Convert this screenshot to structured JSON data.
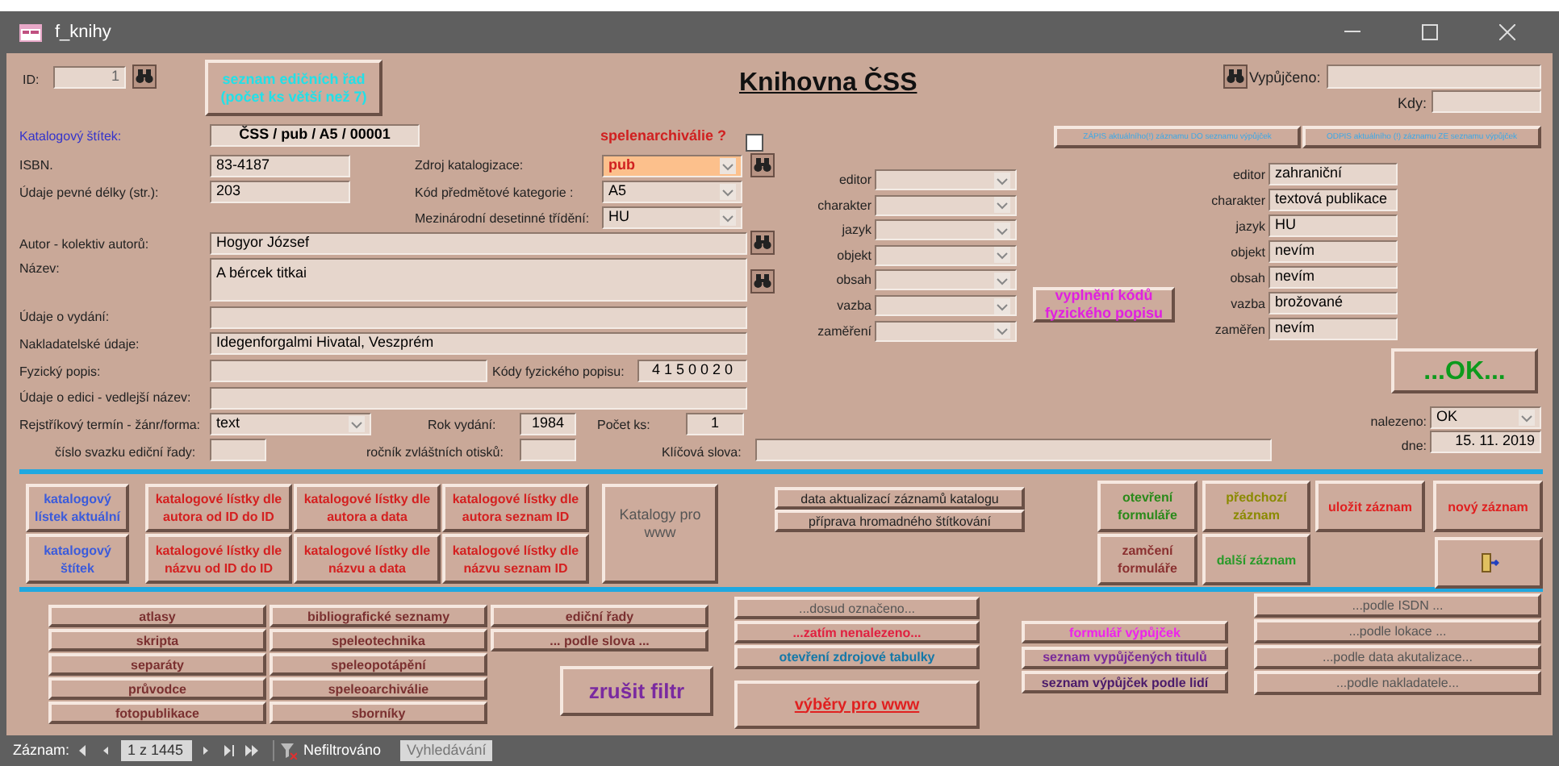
{
  "window": {
    "title": "f_knihy"
  },
  "header": {
    "title": "Knihovna ČSS",
    "id_label": "ID:",
    "id_value": "1",
    "editions_button": "seznam edičních řad (počet ks větší než 7)",
    "loaned_label": "Vypůjčeno:",
    "when_label": "Kdy:"
  },
  "catalog_label": {
    "label": "Katalogový štítek:",
    "value": "ČSS / pub / A5 / 00001"
  },
  "speleo": {
    "label": "spelenarchiválie ?",
    "checked": false
  },
  "loan_buttons": [
    "ZÁPIS aktuálního(!) záznamu DO seznamu výpůjček",
    "ODPIS aktuálního (!) záznamu ZE seznamu výpůjček"
  ],
  "fields": [
    {
      "kind": "text",
      "label": "ISBN.",
      "value": "83-4187",
      "highlighted": false
    },
    {
      "kind": "text",
      "label": "Údaje pevné délky (str.):",
      "value": "203",
      "highlighted": false
    },
    {
      "kind": "combo",
      "label": "Zdroj katalogizace:",
      "value": "pub",
      "highlighted": true
    },
    {
      "kind": "combo",
      "label": "Kód předmětové kategorie :",
      "value": "A5",
      "highlighted": false
    },
    {
      "kind": "combo",
      "label": "Mezinárodní desetinné třídění:",
      "value": "HU",
      "highlighted": false
    },
    {
      "kind": "text",
      "label": "Autor - kolektiv autorů:",
      "value": "Hogyor József",
      "highlighted": false
    },
    {
      "kind": "text",
      "label": "Název:",
      "value": "A bércek titkai",
      "highlighted": false
    },
    {
      "kind": "text",
      "label": "Údaje o vydání:",
      "highlighted": false
    },
    {
      "kind": "text",
      "label": "Nakladatelské údaje:",
      "value": "Idegenforgalmi Hivatal, Veszprém",
      "highlighted": false
    },
    {
      "kind": "text",
      "label": "Fyzický popis:",
      "highlighted": false
    },
    {
      "kind": "text",
      "label": "Kódy fyzického popisu:",
      "value": "4 1 5 0 0 2 0",
      "highlighted": false
    },
    {
      "kind": "text",
      "label": "Údaje o edici - vedlejší název:",
      "highlighted": false
    },
    {
      "kind": "combo",
      "label": "Rejstříkový termín - žánr/forma:",
      "value": "text",
      "highlighted": false
    },
    {
      "kind": "text",
      "label": "Rok vydání:",
      "value": "1984",
      "highlighted": false
    },
    {
      "kind": "text",
      "label": "Počet ks:",
      "value": "1",
      "highlighted": false
    },
    {
      "kind": "text",
      "label": "číslo svazku ediční řady:",
      "highlighted": false
    },
    {
      "kind": "text",
      "label": "ročník zvláštních otisků:",
      "highlighted": false
    },
    {
      "kind": "text",
      "label": "Klíčová slova:",
      "highlighted": false
    }
  ],
  "code_filters": [
    {
      "label": "editor"
    },
    {
      "label": "charakter"
    },
    {
      "label": "jazyk"
    },
    {
      "label": "objekt"
    },
    {
      "label": "obsah"
    },
    {
      "label": "vazba"
    },
    {
      "label": "zaměření"
    }
  ],
  "fill_codes_button": "vyplnění kódů fyzického popisu",
  "code_values": [
    {
      "label": "editor",
      "value": "zahraniční"
    },
    {
      "label": "charakter",
      "value": "textová publikace"
    },
    {
      "label": "jazyk",
      "value": "HU"
    },
    {
      "label": "objekt",
      "value": "nevím"
    },
    {
      "label": "obsah",
      "value": "nevím"
    },
    {
      "label": "vazba",
      "value": "brožované"
    },
    {
      "label": "zaměřen",
      "value": "nevím"
    }
  ],
  "ok_button": "...OK...",
  "found": {
    "label": "nalezeno:",
    "value": "OK"
  },
  "date": {
    "label": "dne:",
    "value": "15. 11. 2019"
  },
  "print_buttons": [
    {
      "label": "katalogový lístek aktuální",
      "color": "#3b5bdb"
    },
    {
      "label": "katalogové lístky dle autora od ID do ID",
      "color": "#d42020"
    },
    {
      "label": "katalogové lístky dle autora a data",
      "color": "#d42020"
    },
    {
      "label": "katalogové lístky dle autora seznam ID",
      "color": "#d42020"
    },
    {
      "label": "Katalogy pro www",
      "color": "#555555"
    },
    {
      "label": "katalogový štítek",
      "color": "#3b5bdb"
    },
    {
      "label": "katalogové lístky dle názvu od ID do ID",
      "color": "#d42020"
    },
    {
      "label": "katalogové lístky dle názvu a data",
      "color": "#d42020"
    },
    {
      "label": "katalogové lístky dle názvu seznam ID",
      "color": "#d42020"
    }
  ],
  "catalog_buttons": [
    "data aktualizací záznamů katalogu",
    "příprava hromadného štítkování"
  ],
  "record_buttons": [
    {
      "kind": "text",
      "label": "otevření formuláře",
      "color": "#2a8a1a"
    },
    {
      "kind": "text",
      "label": "předchozí záznam",
      "color": "#8a8a00"
    },
    {
      "kind": "text",
      "label": "uložit záznam",
      "color": "#e02020"
    },
    {
      "kind": "text",
      "label": "nový záznam",
      "color": "#e02020"
    },
    {
      "kind": "text",
      "label": "zamčení formuláře",
      "color": "#8a3030"
    },
    {
      "kind": "text",
      "label": "další záznam",
      "color": "#2a9a2a"
    },
    {
      "kind": "exit"
    }
  ],
  "filter_buttons": [
    {
      "label": "atlasy"
    },
    {
      "label": "skripta"
    },
    {
      "label": "separáty"
    },
    {
      "label": "průvodce"
    },
    {
      "label": "fotopublikace"
    },
    {
      "label": "bibliografické seznamy"
    },
    {
      "label": "speleotechnika"
    },
    {
      "label": "speleopotápění"
    },
    {
      "label": "speleoarchiválie"
    },
    {
      "label": "sborníky"
    },
    {
      "label": "ediční řady"
    },
    {
      "label": "... podle slova ..."
    }
  ],
  "clear_filter_button": "zrušit filtr",
  "selection_buttons": [
    {
      "label": "...dosud označeno...",
      "color": "#555555"
    },
    {
      "label": "...zatím nenalezeno...",
      "color": "#e02040"
    },
    {
      "label": "otevření zdrojové tabulky",
      "color": "#1478a8"
    },
    {
      "label": "výběry pro www",
      "color": "#e02020"
    }
  ],
  "loan_list_buttons": [
    {
      "label": "formulář výpůjček",
      "color": "#ee22ee"
    },
    {
      "label": "seznam vypůjčených titulů",
      "color": "#7a2a9a"
    },
    {
      "label": "seznam výpůjček podle lidí",
      "color": "#4a1a6a"
    }
  ],
  "search_buttons": [
    "...podle ISDN ...",
    "...podle lokace ...",
    "...podle data akutalizace...",
    "...podle nakladatele..."
  ],
  "status_bar": {
    "record_label": "Záznam:",
    "position": "1 z 1445",
    "filter": "Nefiltrováno",
    "search": "Vyhledávání"
  }
}
